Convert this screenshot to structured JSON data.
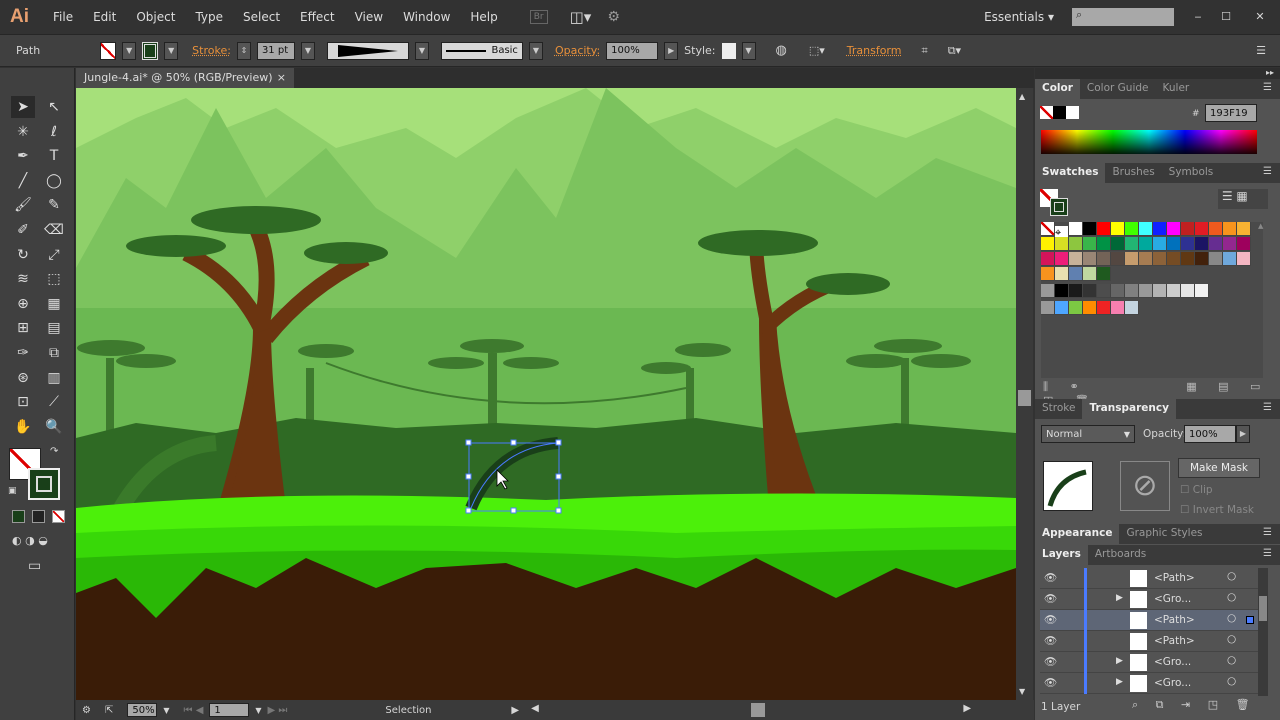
{
  "app": {
    "logo": "Ai",
    "menus": [
      "File",
      "Edit",
      "Object",
      "Type",
      "Select",
      "Effect",
      "View",
      "Window",
      "Help"
    ],
    "bridge": "Br",
    "workspace": "Essentials",
    "search_placeholder": ""
  },
  "control": {
    "selection_type": "Path",
    "stroke_label": "Stroke:",
    "stroke_weight": "31 pt",
    "brush": "Basic",
    "opacity_label": "Opacity:",
    "opacity": "100%",
    "style_label": "Style:",
    "transform_label": "Transform"
  },
  "document": {
    "tab_title": "Jungle-4.ai* @ 50% (RGB/Preview)",
    "close": "×"
  },
  "status": {
    "zoom": "50%",
    "artboard": "1",
    "tool": "Selection"
  },
  "color_panel": {
    "tabs": [
      "Color",
      "Color Guide",
      "Kuler"
    ],
    "hex_label": "#",
    "hex": "193F19"
  },
  "swatches_panel": {
    "tabs": [
      "Swatches",
      "Brushes",
      "Symbols"
    ],
    "rows": [
      [
        "#ffffff",
        "#ffffff",
        "#ffffff",
        "#000000",
        "#ff0000",
        "#ffff00",
        "#40ff00",
        "#40ffff",
        "#1020ff",
        "#ff00ff",
        "#c02020",
        "#e01c24",
        "#f05a1e",
        "#f7941d",
        "#f7b232"
      ],
      [
        "#fff200",
        "#d7df23",
        "#8dc63f",
        "#39b54a",
        "#009245",
        "#006837",
        "#22b573",
        "#00a99d",
        "#29abe2",
        "#0071bc",
        "#2e3192",
        "#1b1464",
        "#662d91",
        "#93278f",
        "#9e005d"
      ],
      [
        "#d4145a",
        "#ed1e79",
        "#c7b299",
        "#998675",
        "#736357",
        "#534741",
        "#c69c6d",
        "#a67c52",
        "#8c6239",
        "#754c24",
        "#603813",
        "#42210b",
        "#888888",
        "#6fa8dc",
        "#f4b6c2"
      ],
      [
        "#f7931e",
        "#e8e0b0",
        "#6080b0",
        "#c0d8a0",
        "#1f5a1f"
      ],
      [
        "#999999",
        "#000000",
        "#1a1a1a",
        "#333333",
        "#4d4d4d",
        "#666666",
        "#808080",
        "#999999",
        "#b3b3b3",
        "#cccccc",
        "#e6e6e6",
        "#f2f2f2"
      ],
      [
        "#999999",
        "#4ea6ff",
        "#7cc843",
        "#ff8c00",
        "#ee2323",
        "#f77fb0",
        "#c4d4e0"
      ]
    ]
  },
  "transparency_panel": {
    "tabs": [
      "Stroke",
      "Transparency"
    ],
    "blend_mode": "Normal",
    "opacity_label": "Opacity:",
    "opacity": "100%",
    "make_mask": "Make Mask",
    "clip": "Clip",
    "invert_mask": "Invert Mask"
  },
  "appearance_tabs": [
    "Appearance",
    "Graphic Styles"
  ],
  "layers_panel": {
    "tabs": [
      "Layers",
      "Artboards"
    ],
    "items": [
      {
        "name": "<Path>",
        "expandable": false,
        "selected": false
      },
      {
        "name": "<Gro...",
        "expandable": true,
        "selected": false
      },
      {
        "name": "<Path>",
        "expandable": false,
        "selected": true
      },
      {
        "name": "<Path>",
        "expandable": false,
        "selected": false
      },
      {
        "name": "<Gro...",
        "expandable": true,
        "selected": false
      },
      {
        "name": "<Gro...",
        "expandable": true,
        "selected": false
      }
    ],
    "count": "1 Layer"
  },
  "colors": {
    "stroke": "#193F19",
    "accent_orange": "#e8903a",
    "layer_bar": "#4a7bff"
  }
}
